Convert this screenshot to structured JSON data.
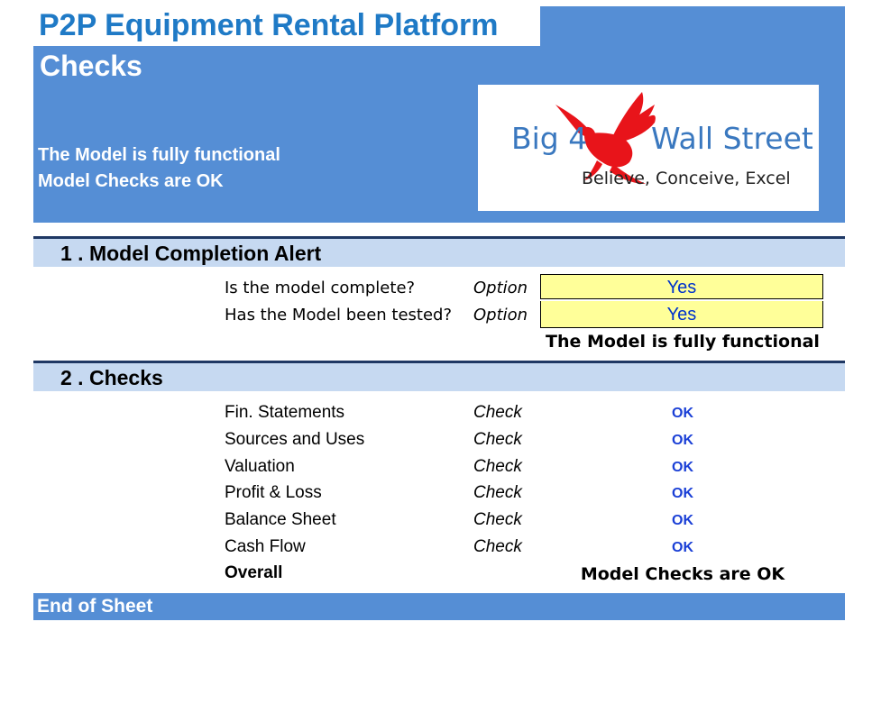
{
  "header": {
    "title": "P2P Equipment Rental Platform",
    "subtitle": "Checks",
    "status_line1": "The Model is fully functional",
    "status_line2": "Model Checks are OK"
  },
  "logo": {
    "text_left": "Big 4",
    "text_right": "Wall Street",
    "tagline": "Believe, Conceive, Excel"
  },
  "section1": {
    "title": "1 . Model Completion Alert",
    "rows": [
      {
        "label": "Is the model complete?",
        "type": "Option",
        "value": "Yes"
      },
      {
        "label": "Has the Model been tested?",
        "type": "Option",
        "value": "Yes"
      }
    ],
    "result": "The Model is fully functional"
  },
  "section2": {
    "title": "2 . Checks",
    "rows": [
      {
        "label": "Fin. Statements",
        "type": "Check",
        "status": "OK"
      },
      {
        "label": "Sources and Uses",
        "type": "Check",
        "status": "OK"
      },
      {
        "label": "Valuation",
        "type": "Check",
        "status": "OK"
      },
      {
        "label": "Profit & Loss",
        "type": "Check",
        "status": "OK"
      },
      {
        "label": "Balance Sheet",
        "type": "Check",
        "status": "OK"
      },
      {
        "label": "Cash Flow",
        "type": "Check",
        "status": "OK"
      }
    ],
    "overall_label": "Overall",
    "overall_result": "Model Checks are OK"
  },
  "footer": {
    "text": "End of Sheet"
  },
  "colors": {
    "header_blue": "#558ed5",
    "title_blue": "#1f7ac6",
    "section_fill": "#c6d9f1",
    "section_rule": "#1f3864",
    "input_fill": "#ffff99",
    "ok_blue": "#1a3fd6",
    "eagle_red": "#e8141a"
  }
}
